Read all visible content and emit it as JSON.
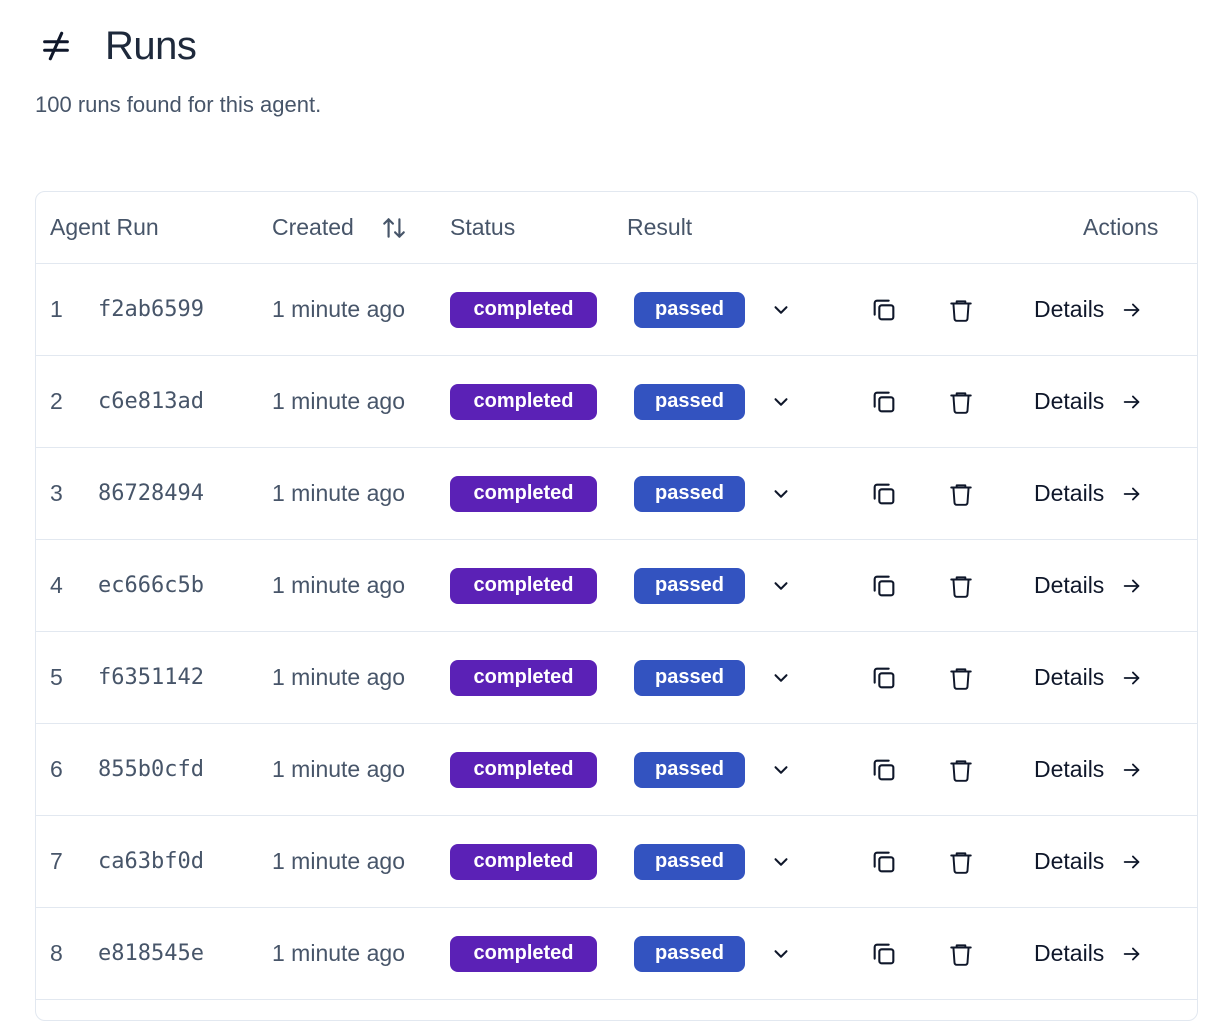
{
  "header": {
    "icon": "not-equal-icon",
    "title": "Runs",
    "subtitle": "100 runs found for this agent."
  },
  "table": {
    "columns": {
      "agent_run": "Agent Run",
      "created": "Created",
      "status": "Status",
      "result": "Result",
      "actions": "Actions"
    },
    "rows": [
      {
        "index": "1",
        "run_id": "f2ab6599",
        "created": "1 minute ago",
        "status": "completed",
        "result": "passed",
        "details": "Details"
      },
      {
        "index": "2",
        "run_id": "c6e813ad",
        "created": "1 minute ago",
        "status": "completed",
        "result": "passed",
        "details": "Details"
      },
      {
        "index": "3",
        "run_id": "86728494",
        "created": "1 minute ago",
        "status": "completed",
        "result": "passed",
        "details": "Details"
      },
      {
        "index": "4",
        "run_id": "ec666c5b",
        "created": "1 minute ago",
        "status": "completed",
        "result": "passed",
        "details": "Details"
      },
      {
        "index": "5",
        "run_id": "f6351142",
        "created": "1 minute ago",
        "status": "completed",
        "result": "passed",
        "details": "Details"
      },
      {
        "index": "6",
        "run_id": "855b0cfd",
        "created": "1 minute ago",
        "status": "completed",
        "result": "passed",
        "details": "Details"
      },
      {
        "index": "7",
        "run_id": "ca63bf0d",
        "created": "1 minute ago",
        "status": "completed",
        "result": "passed",
        "details": "Details"
      },
      {
        "index": "8",
        "run_id": "e818545e",
        "created": "1 minute ago",
        "status": "completed",
        "result": "passed",
        "details": "Details"
      }
    ]
  },
  "colors": {
    "status_completed": "#5b21b6",
    "result_passed": "#3353c0",
    "border": "#e2e8f0",
    "muted_text": "#475569"
  }
}
